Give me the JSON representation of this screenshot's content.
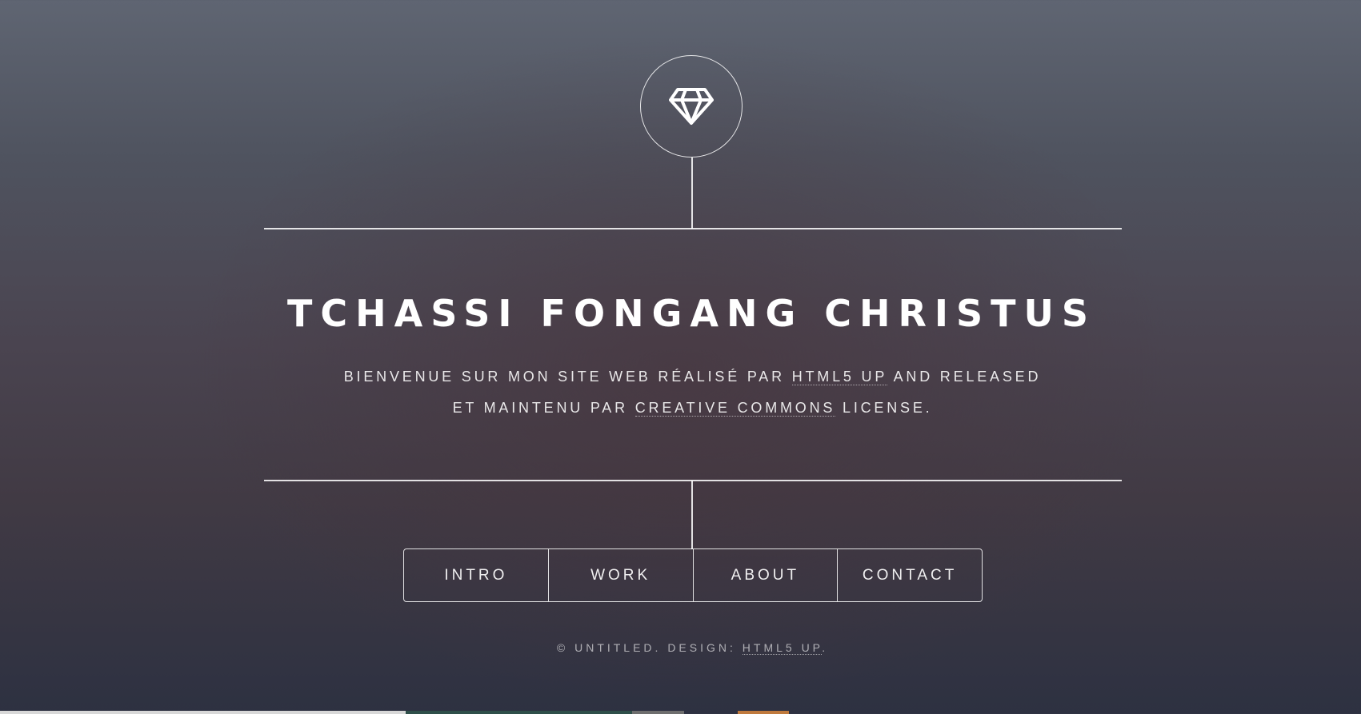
{
  "header": {
    "logo_icon": "diamond-icon",
    "title": "TCHASSI FONGANG CHRISTUS",
    "subtitle_line1_before": "BIENVENUE SUR MON SITE WEB RÉALISÉ PAR ",
    "subtitle_line1_link": "HTML5 UP",
    "subtitle_line1_after": " AND RELEASED",
    "subtitle_line2_before": "ET MAINTENU PAR ",
    "subtitle_line2_link": "CREATIVE COMMONS",
    "subtitle_line2_after": " LICENSE."
  },
  "nav": {
    "items": [
      {
        "label": "INTRO"
      },
      {
        "label": "WORK"
      },
      {
        "label": "ABOUT"
      },
      {
        "label": "CONTACT"
      }
    ]
  },
  "footer": {
    "copyright_before": "© UNTITLED. DESIGN: ",
    "copyright_link": "HTML5 UP",
    "copyright_after": "."
  },
  "colors": {
    "line": "#ffffff",
    "background_top": "#5f6572",
    "background_bottom": "#2d3141"
  }
}
